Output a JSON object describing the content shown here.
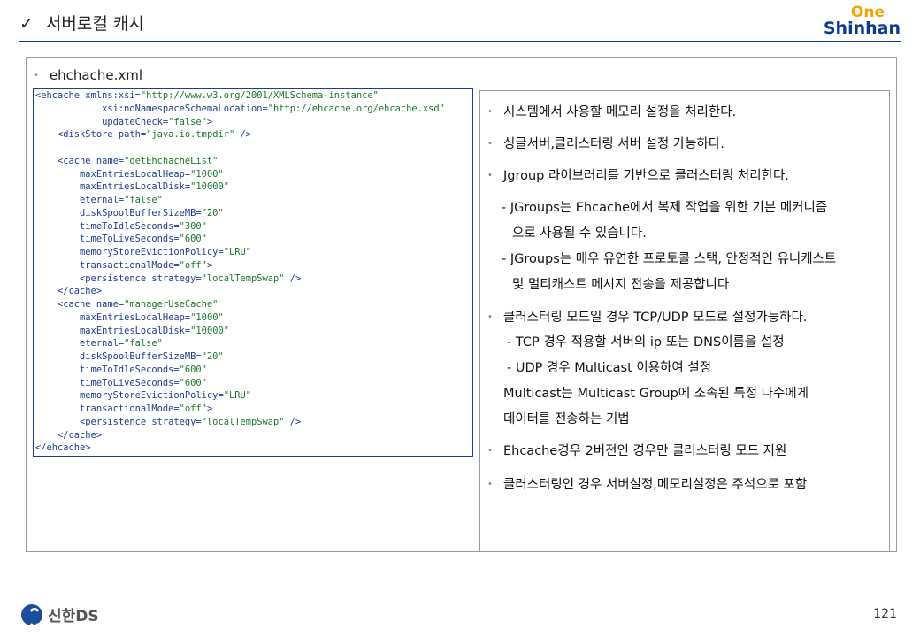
{
  "header": {
    "title": "서버로컬 캐시",
    "check": "✓",
    "logo_top": "One",
    "logo_bottom": "Shinhan"
  },
  "file_title": "ehchache.xml",
  "code_lines": [
    "<ehcache xmlns:xsi=\"http://www.w3.org/2001/XMLSchema-instance\"",
    "            xsi:noNamespaceSchemaLocation=\"http://ehcache.org/ehcache.xsd\"",
    "            updateCheck=\"false\">",
    "    <diskStore path=\"java.io.tmpdir\" />",
    "",
    "    <cache name=\"getEhchacheList\"",
    "        maxEntriesLocalHeap=\"1000\"",
    "        maxEntriesLocalDisk=\"10000\"",
    "        eternal=\"false\"",
    "        diskSpoolBufferSizeMB=\"20\"",
    "        timeToIdleSeconds=\"300\"",
    "        timeToLiveSeconds=\"600\"",
    "        memoryStoreEvictionPolicy=\"LRU\"",
    "        transactionalMode=\"off\">",
    "        <persistence strategy=\"localTempSwap\" />",
    "    </cache>",
    "    <cache name=\"managerUseCache\"",
    "        maxEntriesLocalHeap=\"1000\"",
    "        maxEntriesLocalDisk=\"10000\"",
    "        eternal=\"false\"",
    "        diskSpoolBufferSizeMB=\"20\"",
    "        timeToIdleSeconds=\"600\"",
    "        timeToLiveSeconds=\"600\"",
    "        memoryStoreEvictionPolicy=\"LRU\"",
    "        transactionalMode=\"off\">",
    "        <persistence strategy=\"localTempSwap\" />",
    "    </cache>",
    "</ehcache>"
  ],
  "desc": {
    "b1": "시스템에서 사용할 메모리 설정을 처리한다.",
    "b2": "싱글서버,클러스터링 서버 설정 가능하다.",
    "b3": "Jgroup 라이브러리를 기반으로 클러스터링 처리한다.",
    "b3_s1a": "- JGroups는 Ehcache에서 복제 작업을 위한 기본 메커니즘",
    "b3_s1b": "으로 사용될 수 있습니다.",
    "b3_s2a": "- JGroups는 매우 유연한 프로토콜 스택, 안정적인 유니캐스트",
    "b3_s2b": "및 멀티캐스트 메시지 전송을 제공합니다",
    "b4": "클러스터링 모드일 경우 TCP/UDP 모드로 설정가능하다.",
    "b4_s1": "- TCP 경우 적용할 서버의 ip 또는 DNS이름을 설정",
    "b4_s2": "- UDP 경우 Multicast 이용하여 설정",
    "b4_s3a": "Multicast는 Multicast Group에 소속된 특정 다수에게",
    "b4_s3b": "데이터를 전송하는 기법",
    "b5": "Ehcache경우 2버전인 경우만 클러스터링 모드 지원",
    "b6": "클러스터링인 경우 서버설정,메모리설정은 주석으로 포함"
  },
  "footer": {
    "logo_text": "신한DS",
    "page_number": "121"
  },
  "colors": {
    "brand_blue": "#0d3b8c",
    "brand_orange": "#f0a500",
    "code_border": "#1f3c8c"
  }
}
